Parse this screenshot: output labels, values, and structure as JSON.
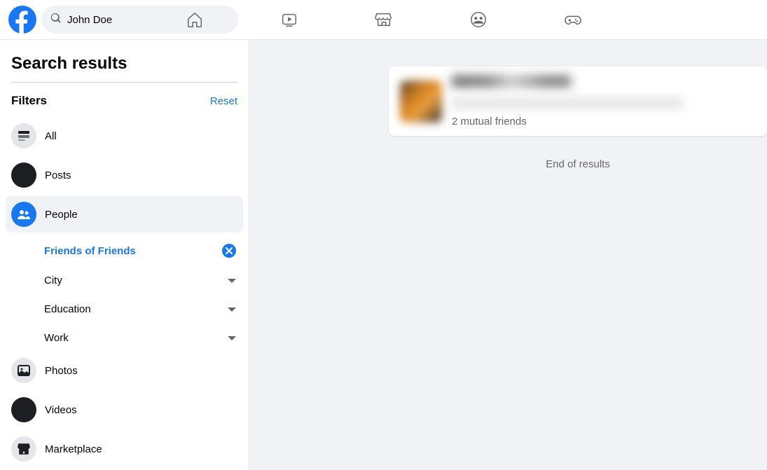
{
  "header": {
    "search_value": "John Doe"
  },
  "sidebar": {
    "title": "Search results",
    "filters_label": "Filters",
    "reset_label": "Reset",
    "items": [
      {
        "label": "All"
      },
      {
        "label": "Posts"
      },
      {
        "label": "People"
      },
      {
        "label": "Photos"
      },
      {
        "label": "Videos"
      },
      {
        "label": "Marketplace"
      }
    ],
    "sub_filters": {
      "friends_of_friends": "Friends of Friends",
      "city": "City",
      "education": "Education",
      "work": "Work"
    }
  },
  "results": {
    "mutual": "2 mutual friends",
    "end": "End of results"
  }
}
